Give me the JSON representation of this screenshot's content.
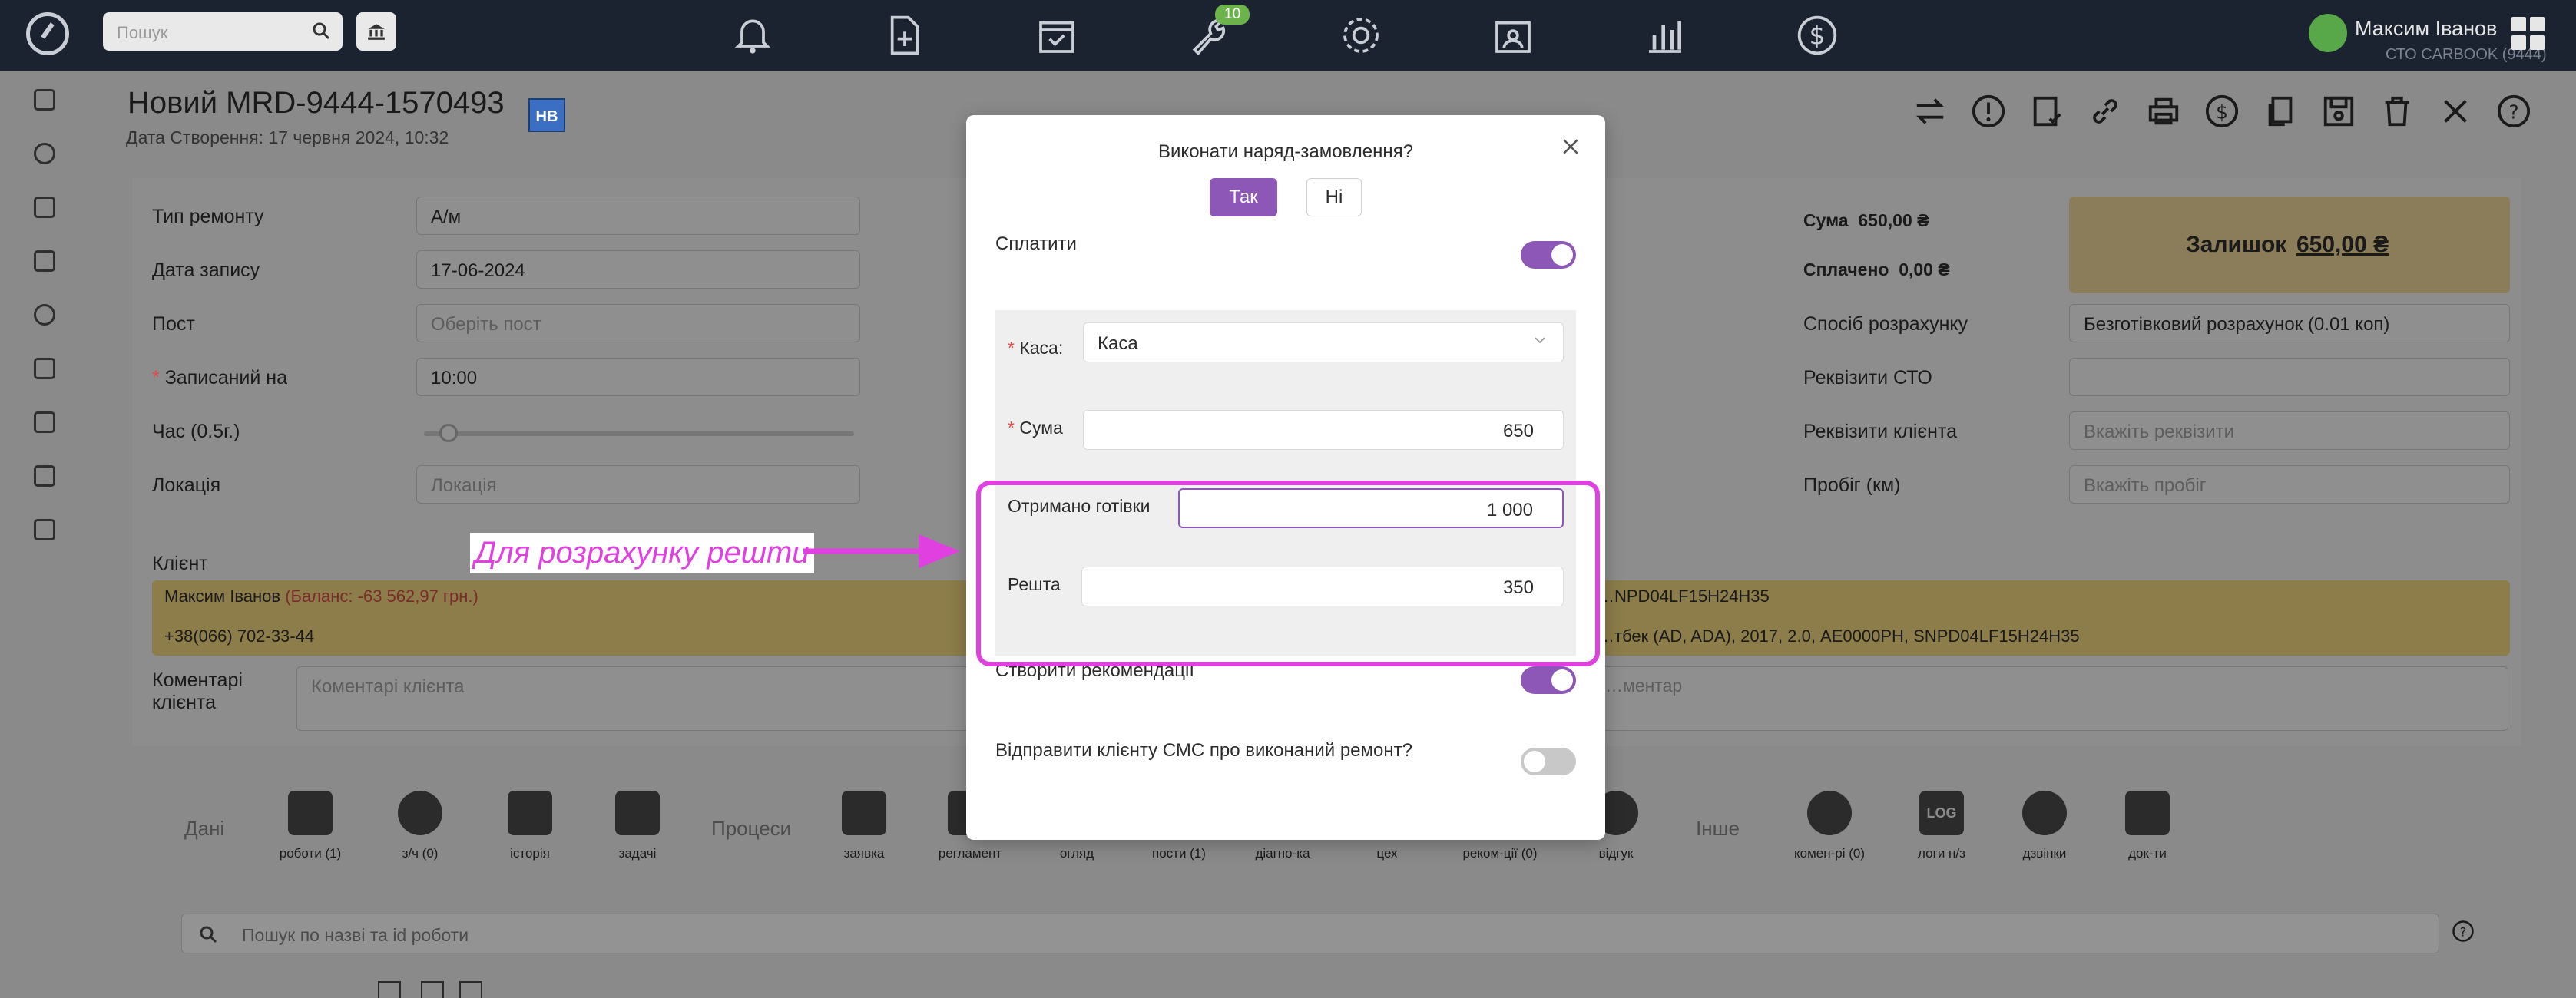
{
  "topbar": {
    "search_placeholder": "Пошук",
    "notification_badge": "10",
    "user_name": "Максим Іванов",
    "user_org": "СТО CARBOOK (9444)"
  },
  "order": {
    "title": "Новий MRD-9444-1570493",
    "status_badge": "НВ",
    "created": "Дата Створення: 17 червня 2024, 10:32"
  },
  "form": {
    "repair_type_label": "Тип ремонту",
    "repair_type_value": "А/м",
    "record_date_label": "Дата запису",
    "record_date_value": "17-06-2024",
    "post_label": "Пост",
    "post_placeholder": "Оберіть пост",
    "booked_label": "Записаний на",
    "booked_value": "10:00",
    "time_label": "Час (0.5г.)",
    "location_label": "Локація",
    "location_placeholder": "Локація",
    "client_label": "Клієнт",
    "client_name": "Максим Іванов",
    "client_balance": "(Баланс: -63 562,97 грн.)",
    "client_phone": "+38(066) 702-33-44",
    "client_vin": "…NPD04LF15H24H35",
    "client_car": "…тбек (AD, ADA), 2017, 2.0, AE0000PH, SNPD04LF15H24H35",
    "comment_label": "Коментарі клієнта",
    "comment_placeholder": "Коментарі клієнта",
    "comment2_placeholder": "…ментар",
    "sum_label": "Сума",
    "sum_value": "650,00 ₴",
    "paid_label": "Сплачено",
    "paid_value": "0,00 ₴",
    "leftover_label": "Залишок",
    "leftover_value": "650,00 ₴",
    "payment_method_label": "Спосіб розрахунку",
    "payment_method_value": "Безготівковий розрахунок (0.01 коп)",
    "sto_requisites_label": "Реквізити СТО",
    "client_requisites_label": "Реквізити клієнта",
    "client_requisites_placeholder": "Вкажіть реквізити",
    "mileage_label": "Пробіг (км)",
    "mileage_placeholder": "Вкажіть пробіг"
  },
  "tabs": {
    "section_data": "Дані",
    "section_processes": "Процеси",
    "section_other": "Інше",
    "items": [
      {
        "label": "роботи (1)"
      },
      {
        "label": "з/ч (0)"
      },
      {
        "label": "історія"
      },
      {
        "label": "задачі"
      },
      {
        "label": "заявка"
      },
      {
        "label": "регламент"
      },
      {
        "label": "огляд"
      },
      {
        "label": "пости (1)"
      },
      {
        "label": "діагно-ка"
      },
      {
        "label": "цех"
      },
      {
        "label": "реком-ції (0)"
      },
      {
        "label": "відгук"
      },
      {
        "label": "комен-рі (0)"
      },
      {
        "label": "логи н/з"
      },
      {
        "label": "дзвінки"
      },
      {
        "label": "док-ти"
      }
    ],
    "log_icon_text": "LOG",
    "work_search_placeholder": "Пошук по назві та id роботи"
  },
  "modal": {
    "title": "Виконати наряд-замовлення?",
    "yes_label": "Так",
    "no_label": "Ні",
    "pay_label": "Сплатити",
    "cash_label": "Каса",
    "cash_colon": ":",
    "cash_value": "Каса",
    "sum_label": "Сума",
    "sum_value": "650",
    "received_label": "Отримано готівки",
    "received_value": "1 000",
    "change_label": "Решта",
    "change_value": "350",
    "create_rec_label": "Створити рекомендації",
    "send_sms_label": "Відправити клієнту СМС про виконаний ремонт?"
  },
  "annotation": {
    "text": "Для розрахунку решти",
    "color": "#e040e0"
  },
  "colors": {
    "accent": "#8c57b6",
    "topbar": "#1b2230",
    "required": "#e54848"
  }
}
